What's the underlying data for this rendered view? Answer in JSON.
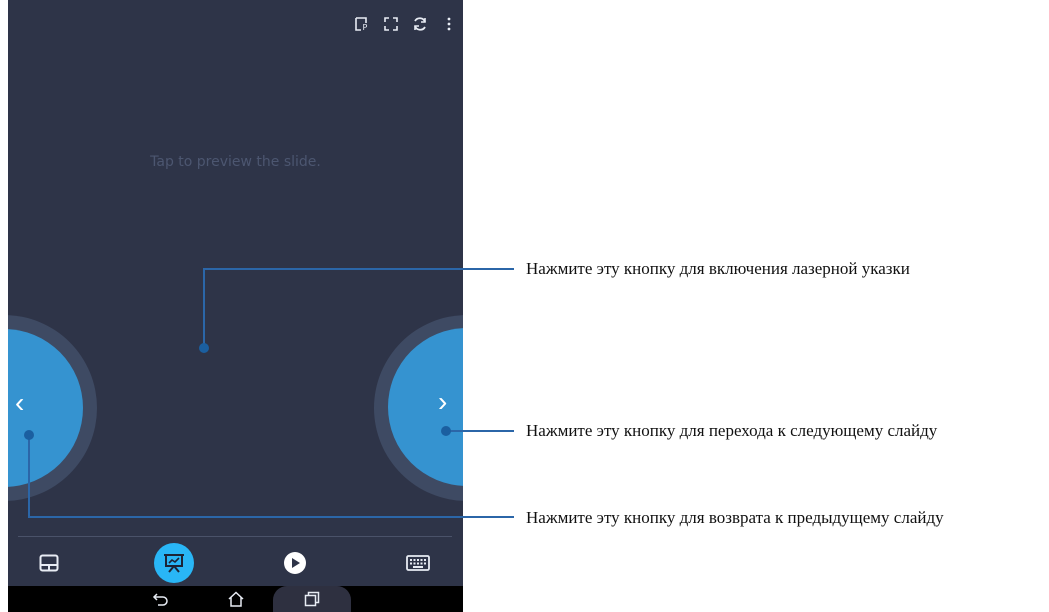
{
  "preview": {
    "hint": "Tap to preview the slide."
  },
  "topbar": {
    "icons": [
      "laser-pointer-icon",
      "fullscreen-icon",
      "refresh-icon",
      "more-options-icon"
    ]
  },
  "nav": {
    "prev_glyph": "‹",
    "next_glyph": "›"
  },
  "toolbar": {
    "icons": [
      "touchpad-icon",
      "presentation-icon",
      "play-icon",
      "keyboard-icon"
    ],
    "active_color": "#29b6f6"
  },
  "system_nav": {
    "icons": [
      "back-icon",
      "home-icon",
      "recent-apps-icon"
    ]
  },
  "callouts": {
    "laser": "Нажмите эту кнопку для включения лазерной указки",
    "next": "Нажмите эту кнопку для перехода к следующему слайду",
    "prev": "Нажмите эту кнопку для возврата к предыдущему слайду"
  },
  "colors": {
    "background": "#2e3448",
    "accent": "#3593d0",
    "callout": "#2b66a8"
  }
}
